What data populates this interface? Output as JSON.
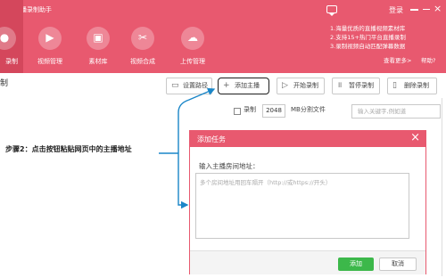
{
  "header": {
    "app_title": "哔哩直播录制助手",
    "login": "登录",
    "nav": [
      {
        "label": "录制",
        "icon": "record-icon"
      },
      {
        "label": "视频管理",
        "icon": "video-manage-icon"
      },
      {
        "label": "素材库",
        "icon": "material-library-icon"
      },
      {
        "label": "视频合成",
        "icon": "scissors-icon"
      },
      {
        "label": "上传管理",
        "icon": "cloud-upload-icon"
      }
    ],
    "promo": [
      "1.海量优质的直播视频素材库",
      "2.支持15+热门平台直播录制",
      "3.录制视频自动匹配弹幕数据"
    ],
    "see_more": "查看更多>",
    "help": "帮助?"
  },
  "toolbar": {
    "left_title": "制",
    "set_path": "设置路径",
    "add_streamer": "添加主播",
    "start_record": "开始录制",
    "pause_record": "暂停录制",
    "delete_record": "删除录制"
  },
  "options": {
    "record_label": "录制",
    "split_size": "2048",
    "split_unit": "MB分割文件",
    "search_placeholder": "输入关键字,例如道"
  },
  "annotation": {
    "step_text": "步骤2：点击按钮粘贴网页中的主播地址"
  },
  "dialog": {
    "title": "添加任务",
    "input_label": "输入主播房间地址：",
    "textarea_placeholder": "多个房间地址用回车隔开（http://或https://开头）",
    "add": "添加",
    "cancel": "取消"
  },
  "colors": {
    "brand": "#e8596f",
    "add_button": "#3cb84a",
    "annotation_line": "#1a86c8"
  }
}
